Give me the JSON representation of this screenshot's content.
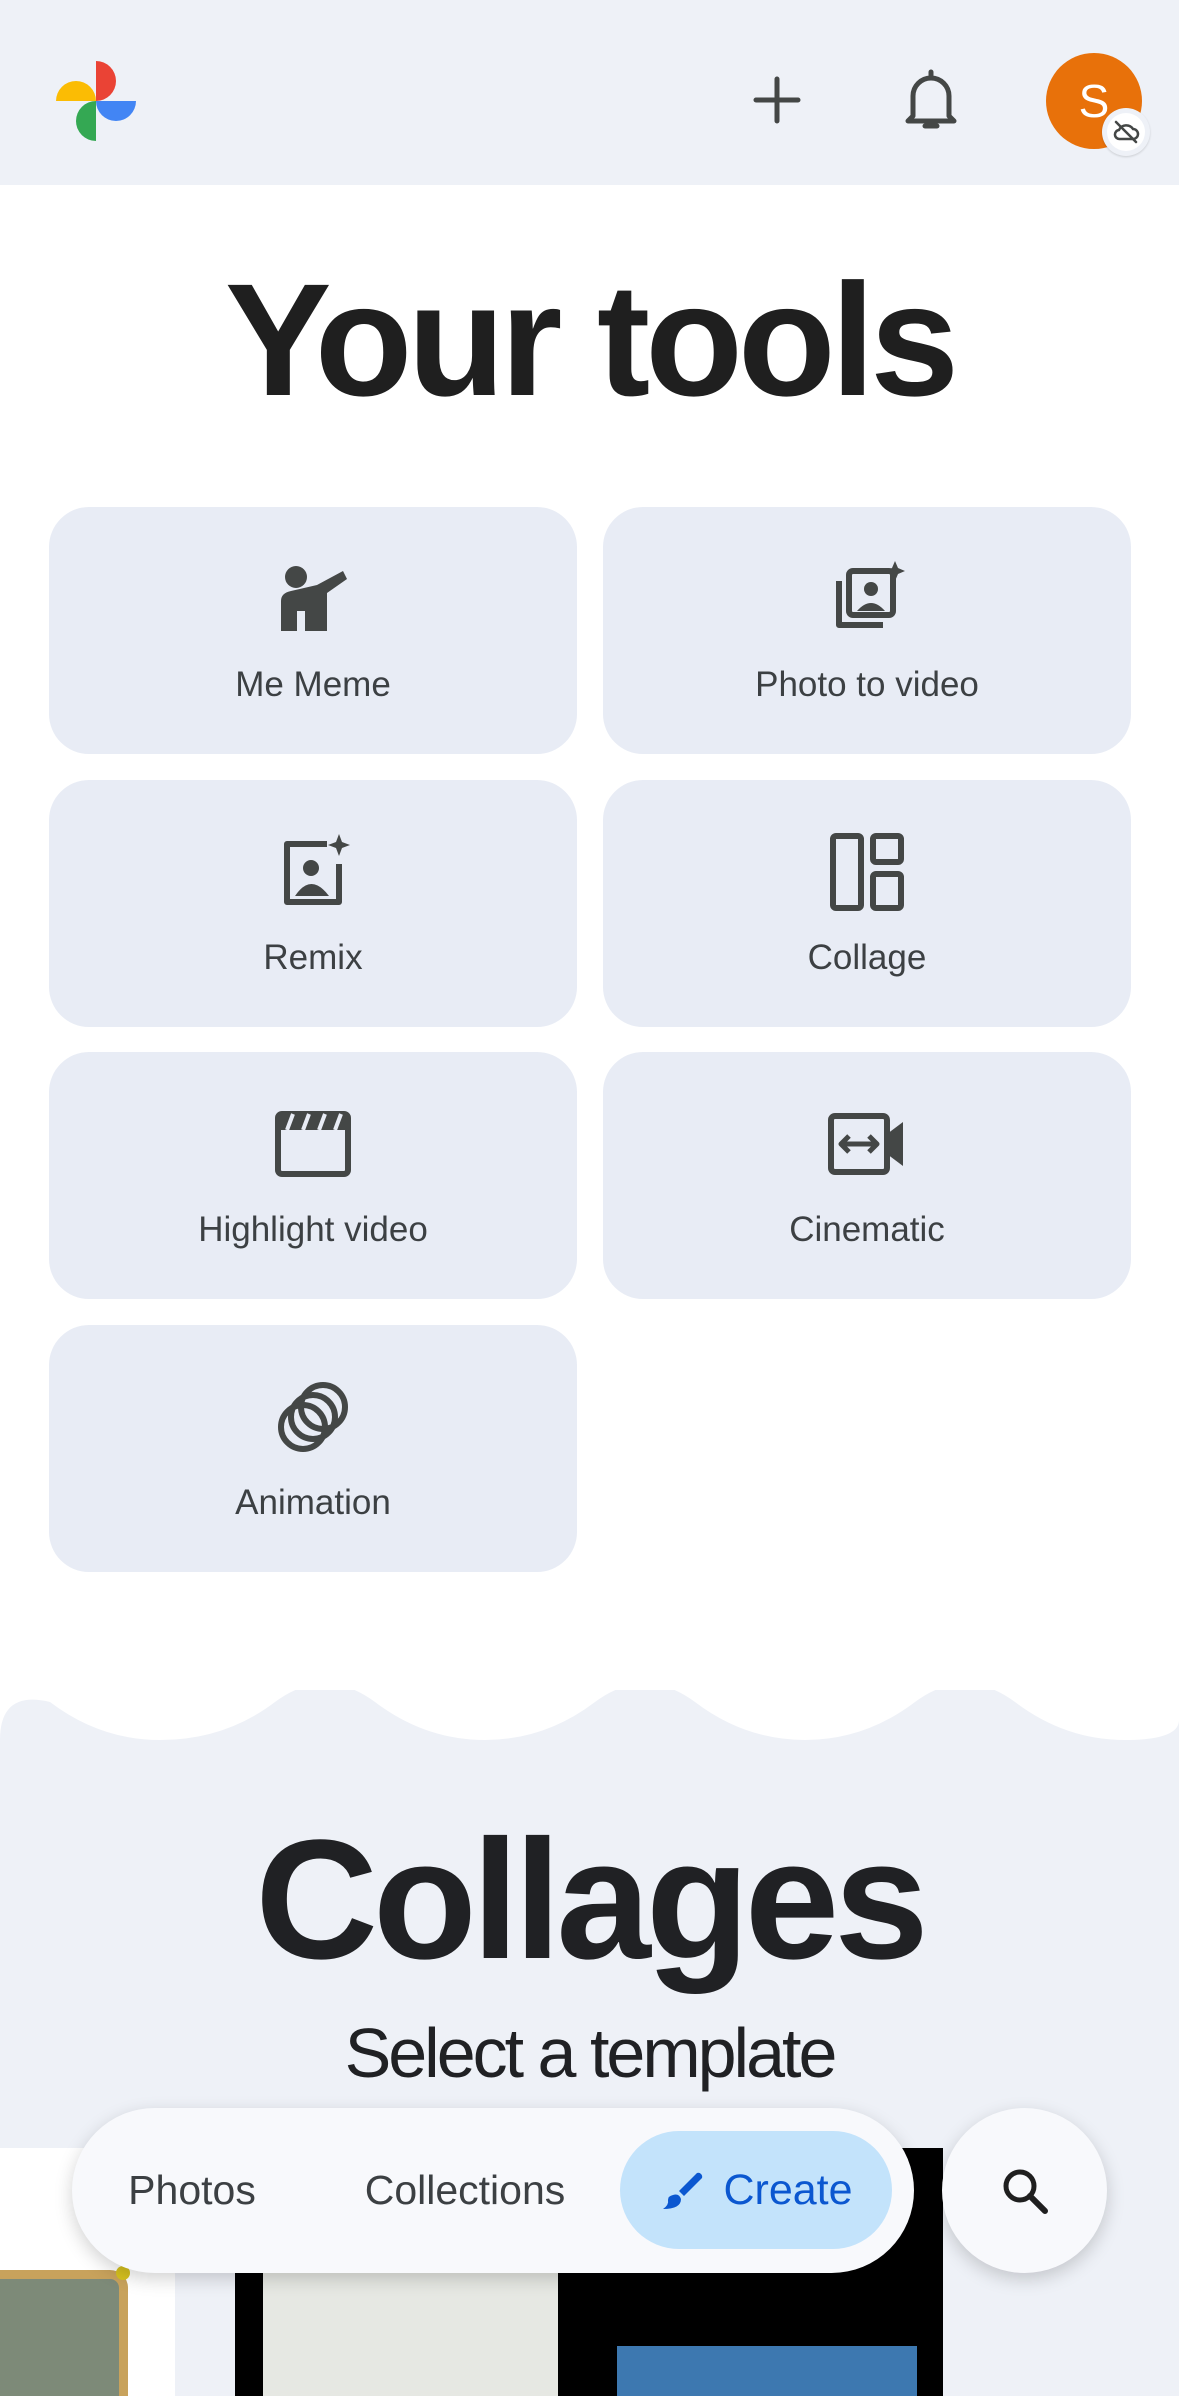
{
  "header": {
    "logo_icon": "google-photos-pinwheel-icon",
    "add_icon": "plus-icon",
    "notifications_icon": "bell-icon",
    "avatar_initial": "S",
    "avatar_color": "#e8710a",
    "avatar_badge_icon": "cloud-off-icon"
  },
  "tools_section": {
    "title": "Your tools",
    "tools": [
      {
        "label": "Me Meme",
        "icon": "me-meme-icon"
      },
      {
        "label": "Photo to video",
        "icon": "photo-to-video-icon"
      },
      {
        "label": "Remix",
        "icon": "remix-icon"
      },
      {
        "label": "Collage",
        "icon": "collage-icon"
      },
      {
        "label": "Highlight video",
        "icon": "movie-clapper-icon"
      },
      {
        "label": "Cinematic",
        "icon": "cinematic-icon"
      },
      {
        "label": "Animation",
        "icon": "animation-icon"
      }
    ]
  },
  "collages_section": {
    "title": "Collages",
    "subtitle": "Select a template"
  },
  "bottom_nav": {
    "items": [
      {
        "label": "Photos"
      },
      {
        "label": "Collections"
      },
      {
        "label": "Create",
        "icon": "brush-icon",
        "selected": true
      }
    ],
    "search_icon": "search-icon",
    "accent_color": "#0b57d0",
    "selected_bg": "#c3e3fb"
  }
}
